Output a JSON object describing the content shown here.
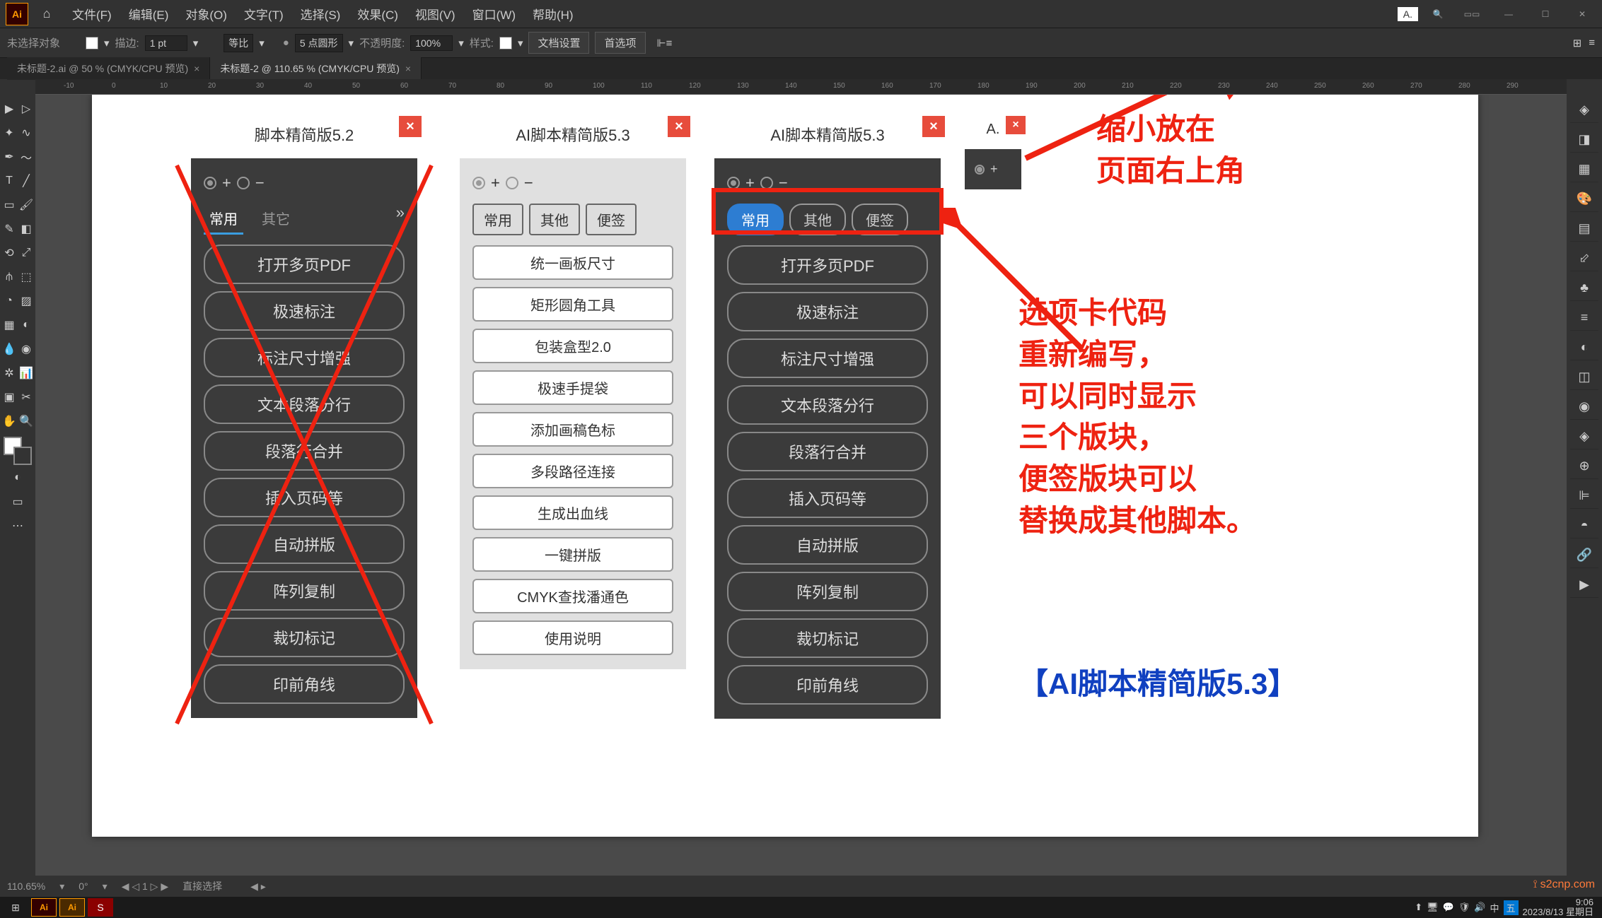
{
  "app": {
    "logo": "Ai"
  },
  "menu": [
    "文件(F)",
    "编辑(E)",
    "对象(O)",
    "文字(T)",
    "选择(S)",
    "效果(C)",
    "视图(V)",
    "窗口(W)",
    "帮助(H)"
  ],
  "pinned_mini": "A.",
  "options": {
    "no_sel": "未选择对象",
    "stroke": "描边:",
    "stroke_val": "1 pt",
    "uniform": "等比",
    "pt5": "5 点圆形",
    "opacity_lbl": "不透明度:",
    "opacity_val": "100%",
    "style": "样式:",
    "docset": "文档设置",
    "prefs": "首选项"
  },
  "doc_tabs": [
    {
      "label": "未标题-2.ai @ 50 % (CMYK/CPU 预览)",
      "active": false
    },
    {
      "label": "未标题-2 @ 110.65 % (CMYK/CPU 预览)",
      "active": true
    }
  ],
  "ruler_marks": [
    -10,
    0,
    10,
    20,
    30,
    40,
    50,
    60,
    70,
    80,
    90,
    100,
    110,
    120,
    130,
    140,
    150,
    160,
    170,
    180,
    190,
    200,
    210,
    220,
    230,
    240,
    250,
    260,
    270,
    280,
    290
  ],
  "panel52": {
    "title": "脚本精简版5.2",
    "tabs": [
      "常用",
      "其它"
    ],
    "buttons": [
      "打开多页PDF",
      "极速标注",
      "标注尺寸增强",
      "文本段落分行",
      "段落行合并",
      "插入页码等",
      "自动拼版",
      "阵列复制",
      "裁切标记",
      "印前角线"
    ]
  },
  "panel53_light": {
    "title": "AI脚本精简版5.3",
    "tabs": [
      "常用",
      "其他",
      "便签"
    ],
    "buttons": [
      "统一画板尺寸",
      "矩形圆角工具",
      "包装盒型2.0",
      "极速手提袋",
      "添加画稿色标",
      "多段路径连接",
      "生成出血线",
      "一键拼版",
      "CMYK查找潘通色",
      "使用说明"
    ]
  },
  "panel53_dark": {
    "title": "AI脚本精简版5.3",
    "tabs": [
      "常用",
      "其他",
      "便签"
    ],
    "buttons": [
      "打开多页PDF",
      "极速标注",
      "标注尺寸增强",
      "文本段落分行",
      "段落行合并",
      "插入页码等",
      "自动拼版",
      "阵列复制",
      "裁切标记",
      "印前角线"
    ]
  },
  "panel_mini": {
    "title": "A."
  },
  "annotations": {
    "top": "缩小放在\n页面右上角",
    "mid": "选项卡代码\n重新编写，\n可以同时显示\n三个版块，\n便签版块可以\n替换成其他脚本。",
    "brand": "【AI脚本精简版5.3】"
  },
  "status": {
    "zoom": "110.65%",
    "angle": "0°",
    "page": "1",
    "tool": "直接选择"
  },
  "taskbar": {
    "time": "9:06",
    "date": "2023/8/13 星期日"
  },
  "watermark": "s2cnp.com"
}
